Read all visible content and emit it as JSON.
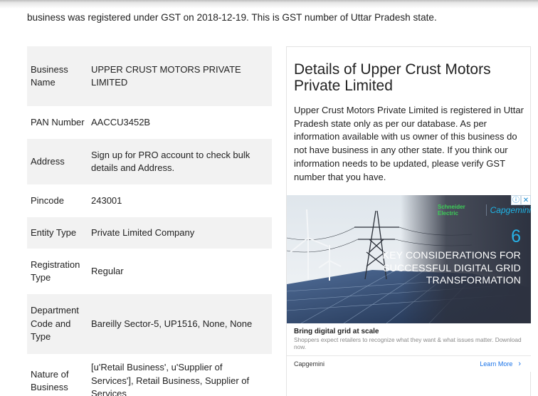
{
  "intro": "business was registered under GST on 2018-12-19. This is GST number of Uttar Pradesh state.",
  "details": [
    {
      "key_lines": [
        "Business",
        "Name"
      ],
      "value_lines": [
        "UPPER CRUST MOTORS PRIVATE LIMITED"
      ]
    },
    {
      "key_lines": [
        "PAN Number"
      ],
      "value_lines": [
        "AACCU3452B"
      ]
    },
    {
      "key_lines": [
        "Address"
      ],
      "value_lines": [
        "Sign up for PRO account to check bulk",
        "details and Address."
      ]
    },
    {
      "key_lines": [
        "Pincode"
      ],
      "value_lines": [
        "243001"
      ]
    },
    {
      "key_lines": [
        "Entity Type"
      ],
      "value_lines": [
        "Private Limited Company"
      ]
    },
    {
      "key_lines": [
        "Registration",
        "Type"
      ],
      "value_lines": [
        "Regular"
      ]
    },
    {
      "key_lines": [
        "Department",
        "Code and",
        "Type"
      ],
      "value_lines": [
        "Bareilly Sector-5, UP1516, None, None"
      ]
    },
    {
      "key_lines": [
        "Nature of",
        "Business"
      ],
      "value_lines": [
        "[u'Retail Business', u'Supplier of",
        "Services'], Retail Business, Supplier of",
        "Services"
      ]
    }
  ],
  "sidebar": {
    "heading": "Details of Upper Crust Motors Private Limited",
    "description": "Upper Crust Motors Private Limited is registered in Uttar Pradesh state only as per our database. As per information available with us owner of this business do not have business in any other state. If you think our information needs to be updated, please verify GST number that you have."
  },
  "ad": {
    "adchoices_icon": "info-icon",
    "close_icon": "close-icon",
    "brand_schneider": "Schneider Electric",
    "brand_capgemini": "Capgemini",
    "number": "6",
    "headline": "KEY CONSIDERATIONS FOR SUCCESSFUL DIGITAL GRID TRANSFORMATION",
    "title": "Bring digital grid at scale",
    "text": "Shoppers expect retailers to recognize what they want & what issues matter. Download now.",
    "advertiser": "Capgemini",
    "cta": "Learn More",
    "colors": {
      "accent": "#27b1e6",
      "brand_green": "#3dcd58",
      "link": "#1a73e8"
    }
  }
}
